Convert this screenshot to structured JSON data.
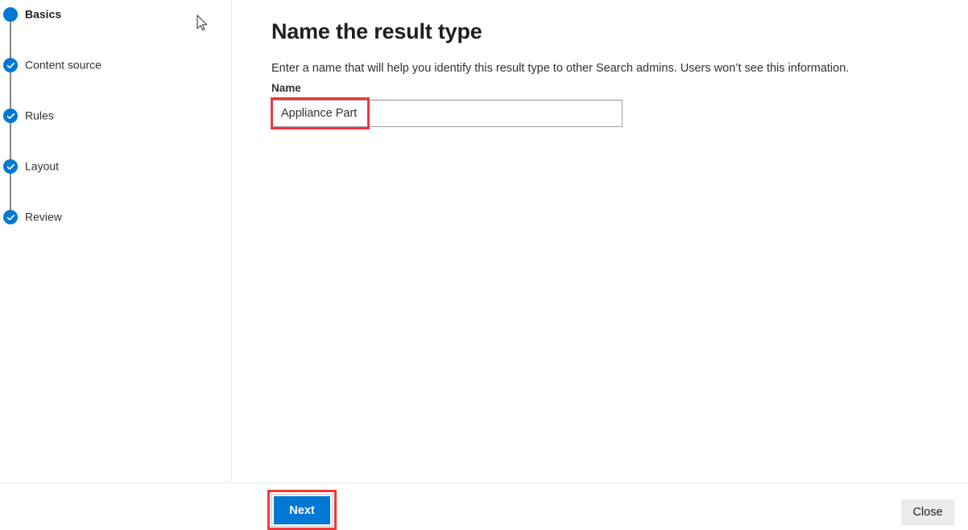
{
  "wizard": {
    "steps": [
      {
        "label": "Basics",
        "state": "current",
        "icon": "filled-circle-icon"
      },
      {
        "label": "Content source",
        "state": "completed",
        "icon": "check-circle-icon"
      },
      {
        "label": "Rules",
        "state": "completed",
        "icon": "check-circle-icon"
      },
      {
        "label": "Layout",
        "state": "completed",
        "icon": "check-circle-icon"
      },
      {
        "label": "Review",
        "state": "completed",
        "icon": "check-circle-icon"
      }
    ]
  },
  "main": {
    "title": "Name the result type",
    "description": "Enter a name that will help you identify this result type to other Search admins. Users won’t see this information.",
    "name_field": {
      "label": "Name",
      "value": "Appliance Part",
      "placeholder": ""
    }
  },
  "footer": {
    "next_label": "Next",
    "close_label": "Close"
  },
  "annotations": [
    {
      "name": "name-field-highlight",
      "color": "#f0383b"
    },
    {
      "name": "next-button-highlight",
      "color": "#f0383b"
    }
  ],
  "cursor": {
    "icon": "mouse-pointer-icon"
  },
  "colors": {
    "accent": "#0078d4",
    "annotation": "#f0383b",
    "text": "#323130",
    "divider": "#e6e6e6"
  }
}
